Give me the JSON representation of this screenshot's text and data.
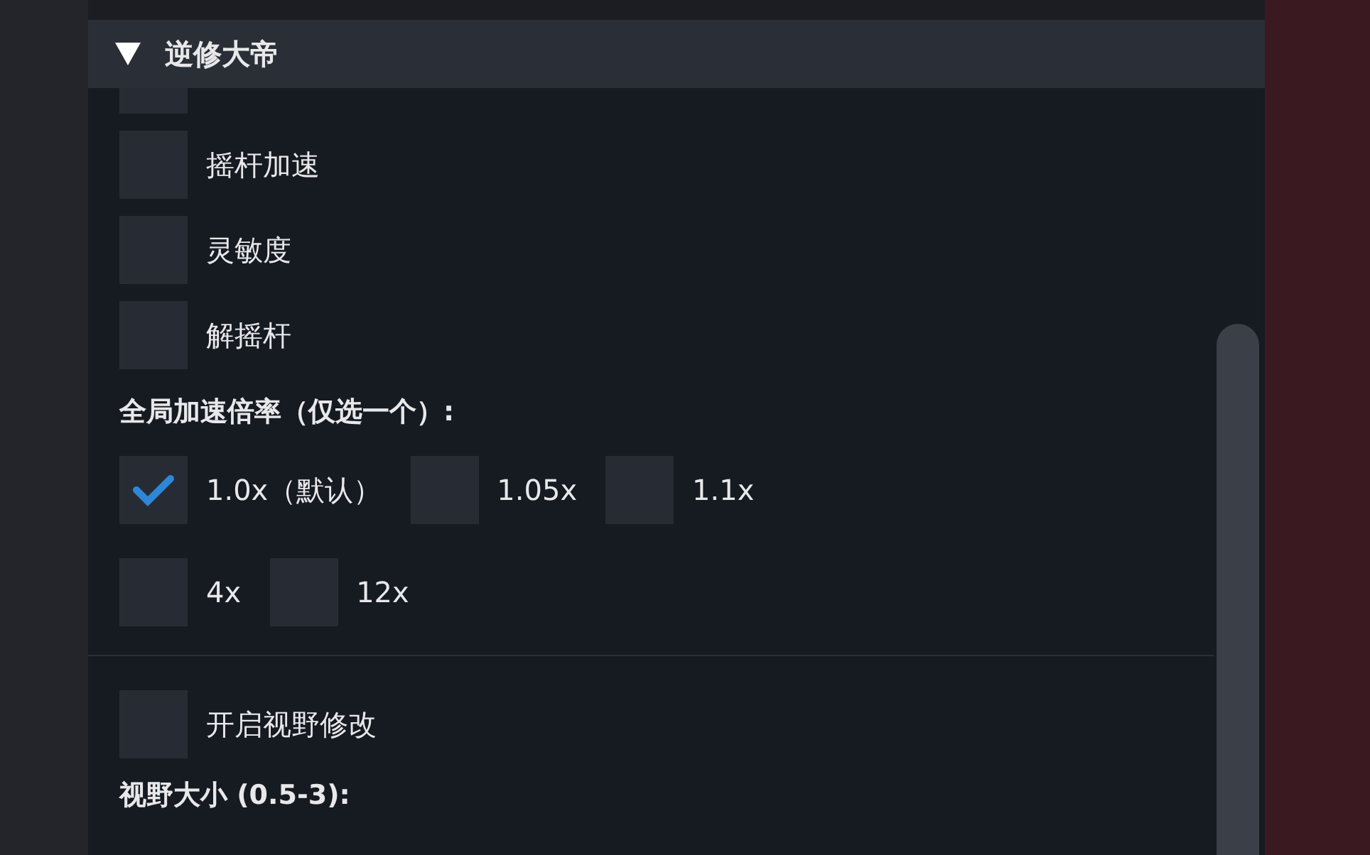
{
  "window": {
    "title": "逆修大帝",
    "expanded": true
  },
  "cut_off_toggle": {
    "checked": false
  },
  "toggles": [
    {
      "label": "摇杆加速",
      "checked": false
    },
    {
      "label": "灵敏度",
      "checked": false
    },
    {
      "label": "解摇杆",
      "checked": false
    }
  ],
  "speed": {
    "label": "全局加速倍率（仅选一个）:",
    "rows": [
      [
        {
          "label": "1.0x（默认）",
          "checked": true
        },
        {
          "label": "1.05x",
          "checked": false
        },
        {
          "label": "1.1x",
          "checked": false
        }
      ],
      [
        {
          "label": "4x",
          "checked": false
        },
        {
          "label": "12x",
          "checked": false
        }
      ]
    ]
  },
  "view_toggle": {
    "label": "开启视野修改",
    "checked": false
  },
  "view_size_label": "视野大小 (0.5-3):"
}
